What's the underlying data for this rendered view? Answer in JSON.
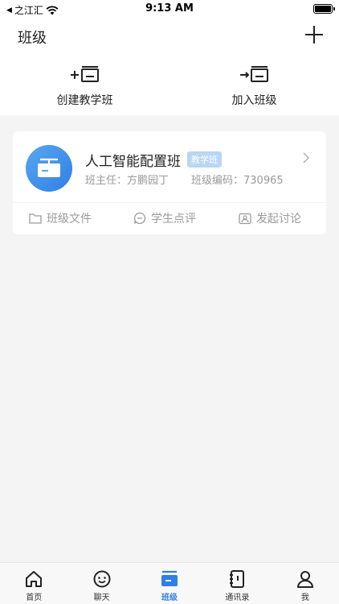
{
  "status_bar": {
    "back_label": "之江汇",
    "time": "9:13 AM"
  },
  "header": {
    "title": "班级"
  },
  "actions": [
    {
      "label": "创建教学班",
      "icon": "create-class-icon"
    },
    {
      "label": "加入班级",
      "icon": "join-class-icon"
    }
  ],
  "class_card": {
    "name": "人工智能配置班",
    "badge": "教学班",
    "teacher_label": "班主任：方鹏园丁",
    "code_label": "班级编码：730965",
    "links": [
      {
        "label": "班级文件",
        "icon": "folder-icon"
      },
      {
        "label": "学生点评",
        "icon": "comment-icon"
      },
      {
        "label": "发起讨论",
        "icon": "discussion-icon"
      }
    ]
  },
  "tabbar": {
    "active": "班级",
    "tabs": [
      {
        "label": "首页",
        "icon": "home-icon"
      },
      {
        "label": "聊天",
        "icon": "chat-icon"
      },
      {
        "label": "班级",
        "icon": "class-icon"
      },
      {
        "label": "通讯录",
        "icon": "contacts-icon"
      },
      {
        "label": "我",
        "icon": "profile-icon"
      }
    ]
  },
  "colors": {
    "accent": "#2f7fe6",
    "badge_bg": "#b9d6f5",
    "muted_text": "#9a9a9a",
    "page_bg": "#f4f4f4"
  }
}
